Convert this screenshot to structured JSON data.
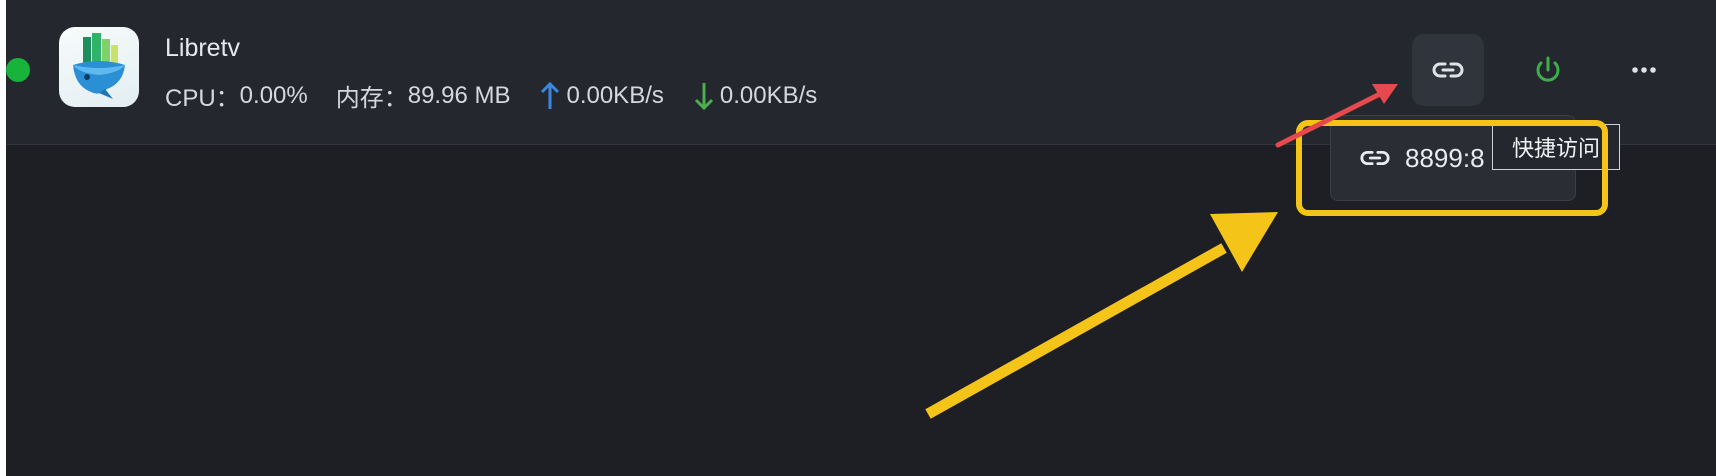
{
  "app": {
    "name": "Libretv",
    "status_color": "#17b33a",
    "stats": {
      "cpu_label": "CPU：",
      "cpu_value": "0.00%",
      "memory_label": "内存：",
      "memory_value": "89.96 MB",
      "upload_value": "0.00KB/s",
      "download_value": "0.00KB/s"
    }
  },
  "actions": {
    "link_icon": "link-icon",
    "power_icon": "power-icon",
    "more_icon": "more-icon"
  },
  "dropdown": {
    "item_label": "8899:8"
  },
  "tooltip": {
    "text": "快捷访问"
  },
  "annotations": {
    "highlight_color": "#f5c419",
    "small_arrow_color": "#e5484d"
  }
}
